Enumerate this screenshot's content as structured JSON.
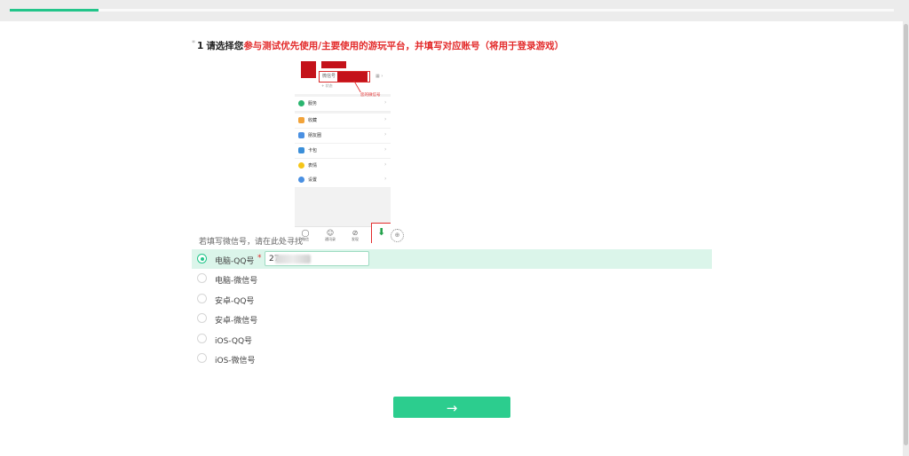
{
  "progress": {
    "percent": 10
  },
  "question": {
    "star": "*",
    "number": "1",
    "text_black": "请选择您",
    "text_red": "参与测试优先使用/主要使用的游玩平台，并填写对应账号（将用于登录游戏）"
  },
  "phone_image": {
    "id_label": "微信号",
    "status": "+ 状态",
    "hint": "您的微信号",
    "menu": [
      "服务",
      "收藏",
      "朋友圈",
      "卡包",
      "表情",
      "设置"
    ],
    "tabs": [
      "微信",
      "通讯录",
      "发现",
      "我"
    ]
  },
  "note": "若填写微信号，请在此处寻找",
  "options": [
    {
      "label": "电脑-QQ号",
      "selected": true,
      "value": "27"
    },
    {
      "label": "电脑-微信号",
      "selected": false
    },
    {
      "label": "安卓-QQ号",
      "selected": false
    },
    {
      "label": "安卓-微信号",
      "selected": false
    },
    {
      "label": "iOS-QQ号",
      "selected": false
    },
    {
      "label": "iOS-微信号",
      "selected": false
    }
  ],
  "required_mark": "*",
  "next_button": {
    "label": "→"
  },
  "colors": {
    "accent": "#2ccd8e",
    "highlight": "#dbf5ea",
    "red": "#e32b2b"
  }
}
